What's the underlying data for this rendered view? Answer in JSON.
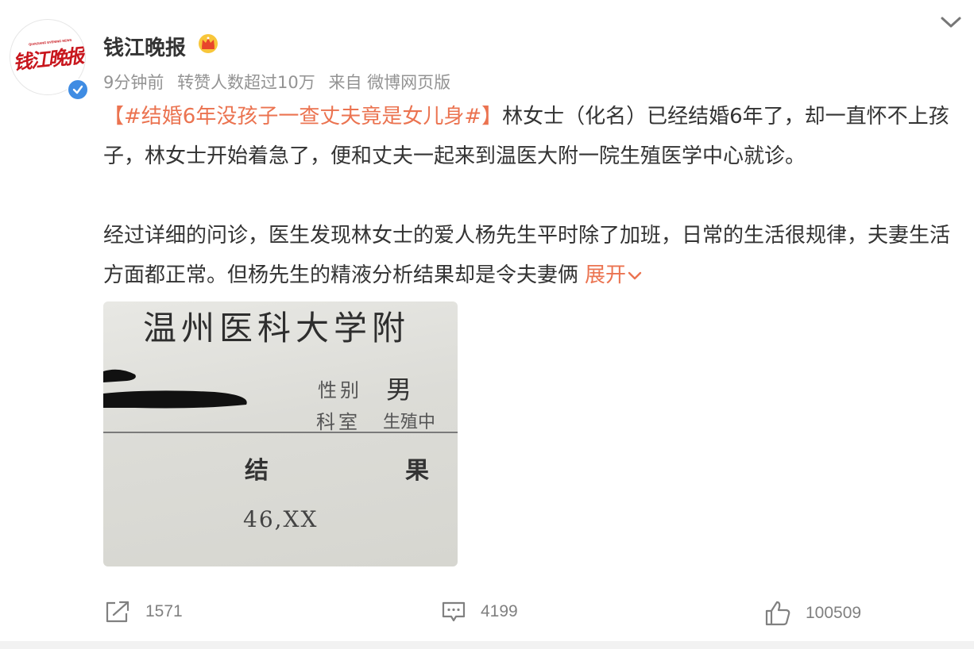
{
  "post": {
    "user_name": "钱江晚报",
    "avatar_text": "钱江晚报",
    "avatar_subtext": "QIANJIANG EVENING NEWS",
    "time": "9分钟前",
    "reposts_note": "转赞人数超过10万",
    "source": "来自 微博网页版",
    "hashtag": "【#结婚6年没孩子一查丈夫竟是女儿身#】",
    "paragraph1_rest": "林女士（化名）已经结婚6年了，却一直怀不上孩子，林女士开始着急了，便和丈夫一起来到温医大附一院生殖医学中心就诊。",
    "paragraph2": "经过详细的问诊，医生发现林女士的爱人杨先生平时除了加班，日常的生活很规律，夫妻生活方面都正常。但杨先生的精液分析结果却是令夫妻俩",
    "expand_label": "展开"
  },
  "image": {
    "title": "温州医科大学附",
    "gender_label": "性别",
    "gender_value": "男",
    "dept_label": "科室",
    "dept_value": "生殖中",
    "result_col1": "结",
    "result_col2": "果",
    "result_value": "46,XX"
  },
  "actions": {
    "repost_count": "1571",
    "comment_count": "4199",
    "like_count": "100509"
  },
  "colors": {
    "accent": "#eb7350",
    "verified": "#3f8ce3",
    "muted": "#939393",
    "brand_red": "#c8161d"
  },
  "icons": {
    "verified": "verified-badge-icon",
    "crown": "crown-icon",
    "more": "chevron-down-icon",
    "repost": "share-icon",
    "comment": "comment-icon",
    "like": "thumbs-up-icon",
    "expand": "chevron-down-icon"
  }
}
